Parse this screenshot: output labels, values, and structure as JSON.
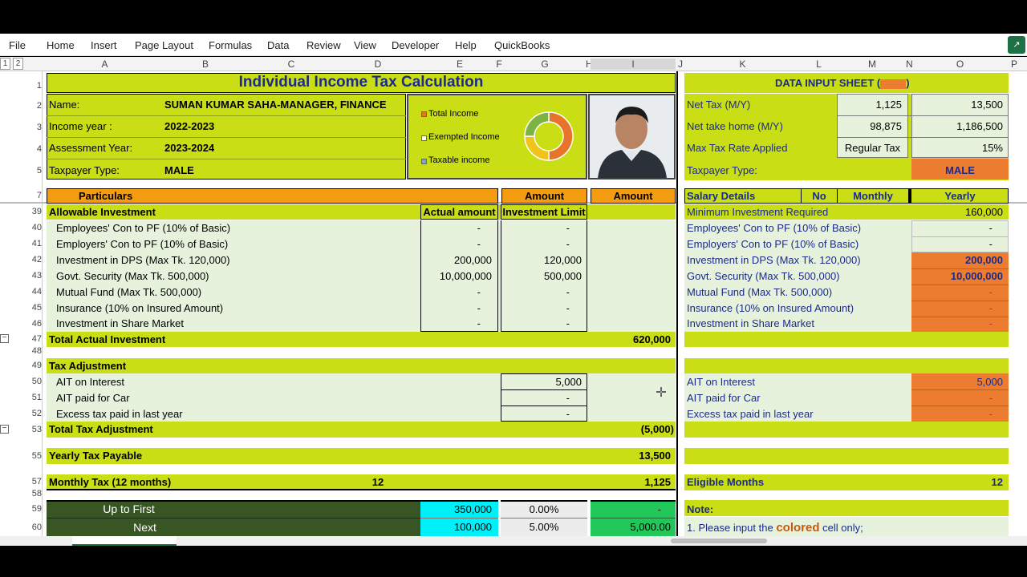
{
  "menu": {
    "items": [
      "File",
      "Home",
      "Insert",
      "Page Layout",
      "Formulas",
      "Data",
      "Review",
      "View",
      "Developer",
      "Help",
      "QuickBooks"
    ]
  },
  "columns": [
    "A",
    "B",
    "C",
    "D",
    "E",
    "F",
    "G",
    "H",
    "I",
    "J",
    "K",
    "L",
    "M",
    "N",
    "O",
    "P"
  ],
  "outline_levels": [
    "1",
    "2"
  ],
  "sheet": {
    "title": "Individual Income Tax Calculation",
    "info": [
      {
        "label": "Name:",
        "value": "SUMAN KUMAR SAHA-MANAGER, FINANCE"
      },
      {
        "label": "Income year :",
        "value": "2022-2023"
      },
      {
        "label": "Assessment Year:",
        "value": "2023-2024"
      },
      {
        "label": "Taxpayer Type:",
        "value": "MALE"
      }
    ],
    "legend": [
      "Total Income",
      "Exempted Income",
      "Taxable income"
    ],
    "particulars_header": "Particulars",
    "amount_header": "Amount",
    "amount_header2": "Amount",
    "allowable": "Allowable Investment",
    "actual_amount": "Actual amount",
    "investment_limit": "Investment Limit",
    "investments": [
      {
        "label": "Employees' Con to PF (10% of Basic)",
        "actual": "-",
        "limit": "-"
      },
      {
        "label": "Employers' Con to PF (10% of Basic)",
        "actual": "-",
        "limit": "-"
      },
      {
        "label": "Investment in DPS (Max Tk. 120,000)",
        "actual": "200,000",
        "limit": "120,000"
      },
      {
        "label": "Govt. Security (Max Tk. 500,000)",
        "actual": "10,000,000",
        "limit": "500,000"
      },
      {
        "label": "Mutual Fund (Max Tk. 500,000)",
        "actual": "-",
        "limit": "-"
      },
      {
        "label": "Insurance (10% on Insured Amount)",
        "actual": "-",
        "limit": "-"
      },
      {
        "label": "Investment in Share Market",
        "actual": "-",
        "limit": "-"
      }
    ],
    "total_actual_label": "Total Actual Investment",
    "total_actual_value": "620,000",
    "tax_adjustment": "Tax Adjustment",
    "adjustments": [
      {
        "label": "AIT on Interest",
        "value": "5,000"
      },
      {
        "label": "AIT paid for Car",
        "value": "-"
      },
      {
        "label": "Excess tax paid in last year",
        "value": "-"
      }
    ],
    "total_adj_label": "Total Tax Adjustment",
    "total_adj_value": "(5,000)",
    "yearly_label": "Yearly Tax Payable",
    "yearly_value": "13,500",
    "monthly_label": "Monthly Tax (12 months)",
    "monthly_months": "12",
    "monthly_value": "1,125",
    "slabs": [
      {
        "label": "Up to First",
        "amount": "350,000",
        "rate": "0.00%",
        "tax": "-"
      },
      {
        "label": "Next",
        "amount": "100,000",
        "rate": "5.00%",
        "tax": "5,000.00"
      }
    ]
  },
  "input": {
    "title": "DATA INPUT SHEET (",
    "title_end": ")",
    "rows": [
      {
        "label": "Net Tax (M/Y)",
        "m": "1,125",
        "y": "13,500"
      },
      {
        "label": "Net take home (M/Y)",
        "m": "98,875",
        "y": "1,186,500"
      },
      {
        "label": "Max Tax Rate Applied",
        "m": "Regular Tax",
        "y": "15%"
      }
    ],
    "taxpayer_label": "Taxpayer Type:",
    "taxpayer_value": "MALE",
    "salary_details": "Salary Details",
    "no": "No",
    "monthly": "Monthly",
    "yearly": "Yearly",
    "min_inv_label": "Minimum Investment Required",
    "min_inv_value": "160,000",
    "investments": [
      {
        "label": "Employees' Con to PF (10% of Basic)",
        "value": "-"
      },
      {
        "label": "Employers' Con to PF (10% of Basic)",
        "value": "-"
      },
      {
        "label": "Investment in DPS (Max Tk. 120,000)",
        "value": "200,000"
      },
      {
        "label": "Govt. Security (Max Tk. 500,000)",
        "value": "10,000,000"
      },
      {
        "label": "Mutual Fund (Max Tk. 500,000)",
        "value": "-"
      },
      {
        "label": "Insurance (10% on Insured Amount)",
        "value": "-"
      },
      {
        "label": "Investment in Share Market",
        "value": "-"
      }
    ],
    "adjustments": [
      {
        "label": "AIT on Interest",
        "value": "5,000"
      },
      {
        "label": "AIT paid for Car",
        "value": "-"
      },
      {
        "label": "Excess tax paid in last year",
        "value": "-"
      }
    ],
    "eligible_label": "Eligible Months",
    "eligible_value": "12",
    "note": "Note:",
    "note1_pre": "1. Please input the",
    "note1_colored": "colored",
    "note1_post": "cell only;"
  },
  "row_numbers": [
    "1",
    "2",
    "3",
    "4",
    "5",
    "7",
    "39",
    "40",
    "41",
    "42",
    "43",
    "44",
    "45",
    "46",
    "47",
    "48",
    "49",
    "50",
    "51",
    "52",
    "53",
    "55",
    "57",
    "58",
    "59",
    "60"
  ],
  "donut": {
    "segments": [
      {
        "name": "Total Income",
        "value": 50,
        "color": "#e8732a"
      },
      {
        "name": "Exempted Income",
        "value": 25,
        "color": "#f0c419"
      },
      {
        "name": "Taxable income",
        "value": 25,
        "color": "#7cb342"
      }
    ]
  },
  "colors": {
    "lime": "#c9de14",
    "orange": "#f39c12",
    "input_orange": "#ec7c30",
    "navy": "#1c2a8a",
    "dark_green": "#375623",
    "cyan": "#00f0f8",
    "green": "#22c75a"
  }
}
